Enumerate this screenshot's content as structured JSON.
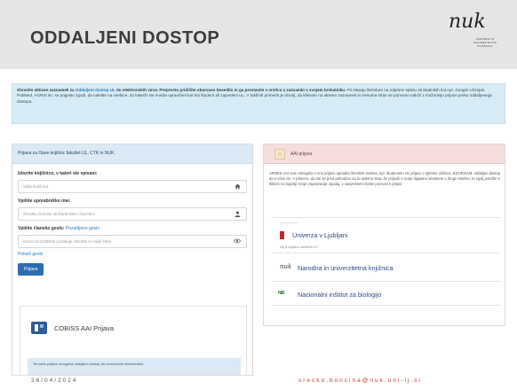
{
  "slide": {
    "title": "ODDALJENI DOSTOP",
    "logo": {
      "mark": "nuk",
      "lines": [
        "NARODNA IN",
        "UNIVERZITETNA",
        "KNJIŽNICA"
      ]
    },
    "footer_date": "26/04/2024",
    "footer_email": "srecko.boncina@nuk.uni-lj.si"
  },
  "info": {
    "lead_1": "Shranite aktiven zaznamek za ",
    "lead_link": "Oddaljeni dostop UL",
    "lead_2": " do elektronskih virov. Preprosto pridržite obarvano besedilo in ga prestavite v vrstico z zaznamki v svojem brskalniku.",
    "body_1": " Pri iskanju literature na odprtem spletu ali iskalnikih kot npr. Google Učenjak, PubMed, AGRIS itn. se pogosto zgodi, da naletite na vsebine, do katerih ste morda upravičeni kot kot študent ali zaposleni UL. V takšnih primerih je dovolj, da kliknete na aktiven zaznamek in trenutna stran se ponovno naloži z možnostjo prijave preko oddaljenega dostopa."
  },
  "left": {
    "header": "Prijava za člane knjižnic fakultet UL, CTK in NUK.",
    "library_label": "Izberite knjižnico, v kateri ste vpisani:",
    "library_placeholder": "Vaša knjižnica",
    "username_label": "Vpišite uporabniško ime:",
    "username_placeholder": "Številka članske ali študentske izkaznice",
    "password_label": "Vpišite člansko geslo:",
    "password_hint": "Pozabljeno geslo",
    "password_placeholder": "Geslo za COBISS (razlikuje VELIKE in male črke)",
    "show_password": "Pokaži geslo",
    "login_button": "Prijava",
    "cobiss_label": "COBISS AAI Prijava",
    "cobiss_note": "Ta način prijave omogoča oddaljeni dostop do nenročenih elektronskih"
  },
  "right": {
    "header": "AAI prijava",
    "description": "ARNES AAI vam omogoča z eno prijavo uporabo številnih storitev, npr. študentom UL prijavo v spletne učilnice, EDUROAM, oddaljen dostop do e-virov itn. V primeru, da ste se pred prihodom na to spletno stran že prijavili s svojo digitalno identiteto v drugo storitev, to zgolj potrdite s klikom na logotip svoje organizacije zgodaj, v nasprotnem boste pozvani k prijavi.",
    "institutions": [
      {
        "name": "Univerza v Ljubljani",
        "top_note": "–––––––––––",
        "sub": "Kaj je digitalna identiteta UL?"
      },
      {
        "name": "Narodna in univerzitetna knjižnica",
        "logo": "nuk"
      },
      {
        "name": "Nacionalni inštitut za biologijo",
        "logo": "NIB"
      }
    ]
  },
  "colors": {
    "header_band": "#e6e6e6",
    "info_bg": "#d8ecf6",
    "aai_head_bg": "#f6dede",
    "button": "#2c6db2",
    "ul_red": "#c0272d",
    "email": "#c0392b"
  }
}
